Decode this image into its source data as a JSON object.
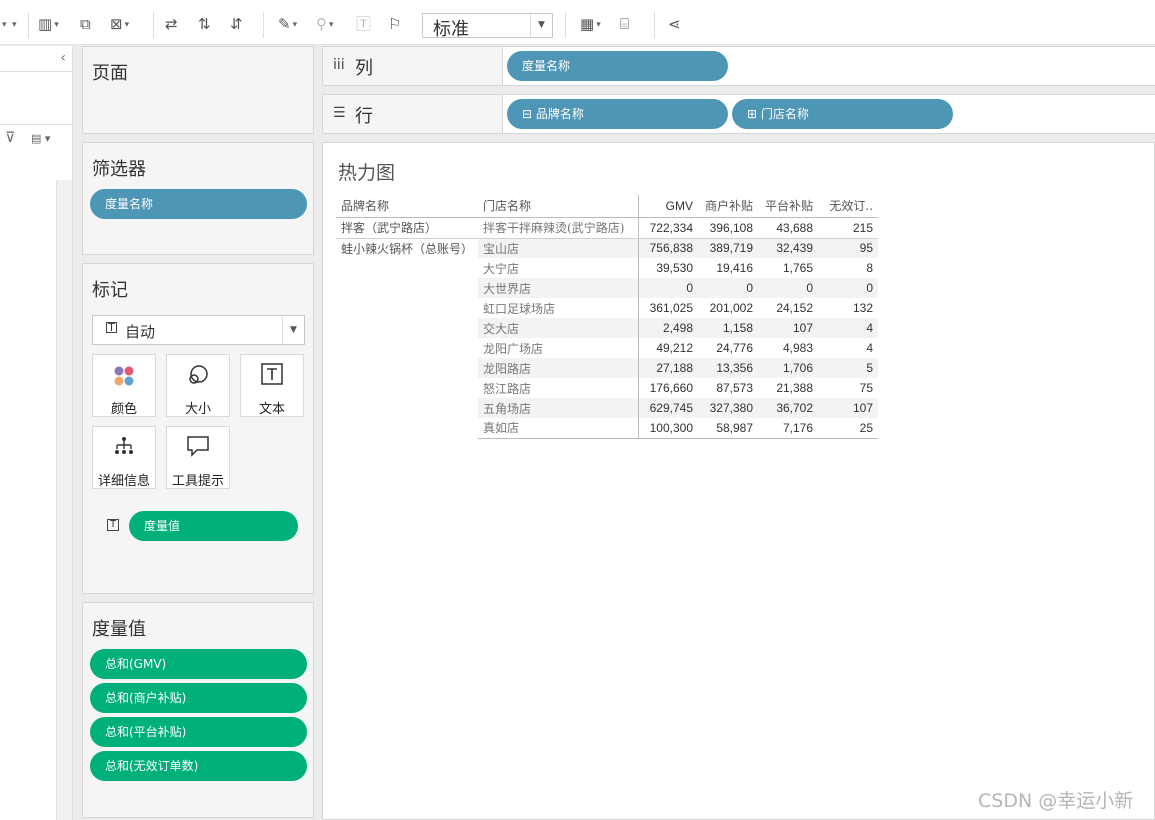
{
  "toolbar": {
    "fit_value": "标准",
    "icons": [
      "show-me-chart-icon",
      "duplicate-icon",
      "clear-sheet-icon",
      "swap-icon",
      "sort-ascending-icon",
      "sort-descending-icon",
      "highlight-icon",
      "group-icon",
      "label-icon",
      "pin-icon",
      "show-me-icon",
      "presentation-icon",
      "share-icon"
    ]
  },
  "cards": {
    "pages": {
      "title": "页面"
    },
    "filters": {
      "title": "筛选器",
      "pills": [
        "度量名称"
      ]
    },
    "marks": {
      "title": "标记",
      "type": "自动",
      "buttons": [
        {
          "label": "颜色",
          "icon": "color-dots-icon"
        },
        {
          "label": "大小",
          "icon": "size-icon"
        },
        {
          "label": "文本",
          "icon": "text-icon"
        },
        {
          "label": "详细信息",
          "icon": "detail-icon"
        },
        {
          "label": "工具提示",
          "icon": "tooltip-icon"
        }
      ],
      "text_pill": "度量值"
    },
    "measure_values": {
      "title": "度量值",
      "pills": [
        "总和(GMV)",
        "总和(商户补贴)",
        "总和(平台补贴)",
        "总和(无效订单数)"
      ]
    }
  },
  "shelves": {
    "columns": {
      "icon": "iii",
      "label": "列",
      "pills": [
        "度量名称"
      ]
    },
    "rows": {
      "icon": "☰",
      "label": "行",
      "pills": [
        "⊟ 品牌名称",
        "⊞ 门店名称"
      ]
    }
  },
  "sheet": {
    "title": "热力图",
    "headers": [
      "品牌名称",
      "门店名称",
      "GMV",
      "商户补贴",
      "平台补贴",
      "无效订.."
    ],
    "rows": [
      {
        "brand": "拌客（武宁路店）",
        "store": "拌客干拌麻辣烫(武宁路店)",
        "gmv": "722,334",
        "merchant": "396,108",
        "platform": "43,688",
        "invalid": "215"
      },
      {
        "brand": "蛙小辣火锅杯（总账号）",
        "store": "宝山店",
        "gmv": "756,838",
        "merchant": "389,719",
        "platform": "32,439",
        "invalid": "95"
      },
      {
        "brand": "",
        "store": "大宁店",
        "gmv": "39,530",
        "merchant": "19,416",
        "platform": "1,765",
        "invalid": "8"
      },
      {
        "brand": "",
        "store": "大世界店",
        "gmv": "0",
        "merchant": "0",
        "platform": "0",
        "invalid": "0"
      },
      {
        "brand": "",
        "store": "虹口足球场店",
        "gmv": "361,025",
        "merchant": "201,002",
        "platform": "24,152",
        "invalid": "132"
      },
      {
        "brand": "",
        "store": "交大店",
        "gmv": "2,498",
        "merchant": "1,158",
        "platform": "107",
        "invalid": "4"
      },
      {
        "brand": "",
        "store": "龙阳广场店",
        "gmv": "49,212",
        "merchant": "24,776",
        "platform": "4,983",
        "invalid": "4"
      },
      {
        "brand": "",
        "store": "龙阳路店",
        "gmv": "27,188",
        "merchant": "13,356",
        "platform": "1,706",
        "invalid": "5"
      },
      {
        "brand": "",
        "store": "怒江路店",
        "gmv": "176,660",
        "merchant": "87,573",
        "platform": "21,388",
        "invalid": "75"
      },
      {
        "brand": "",
        "store": "五角场店",
        "gmv": "629,745",
        "merchant": "327,380",
        "platform": "36,702",
        "invalid": "107"
      },
      {
        "brand": "",
        "store": "真如店",
        "gmv": "100,300",
        "merchant": "58,987",
        "platform": "7,176",
        "invalid": "25"
      }
    ]
  },
  "watermark": "CSDN @幸运小新",
  "colors": {
    "blue_pill": "#4e96b5",
    "green_pill": "#00b07a"
  }
}
